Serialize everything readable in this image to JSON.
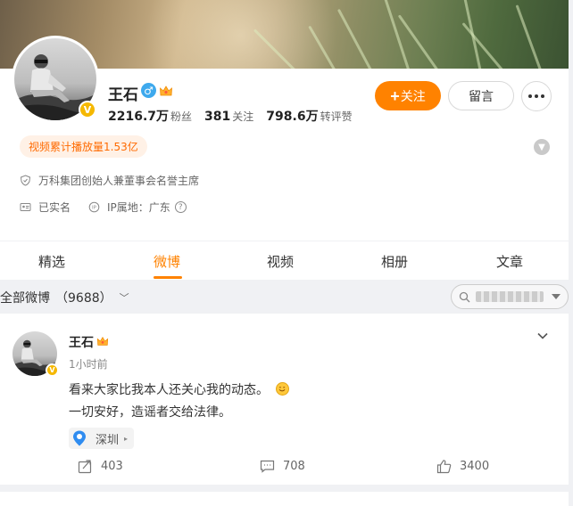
{
  "profile": {
    "name": "王石",
    "verified_badge": "V",
    "stats": [
      {
        "value": "2216.7万",
        "label": "粉丝"
      },
      {
        "value": "381",
        "label": "关注"
      },
      {
        "value": "798.6万",
        "label": "转评赞"
      }
    ],
    "follow_label": "关注",
    "message_label": "留言",
    "video_views": "视频累计播放量1.53亿",
    "description": "万科集团创始人兼董事会名誉主席",
    "real_name": "已实名",
    "ip_location": "IP属地：广东",
    "help_symbol": "?",
    "icons": [
      "gender-male-icon",
      "crown-icon",
      "more-icon",
      "expand-icon",
      "shield-icon",
      "id-card-icon",
      "ip-icon",
      "help-icon"
    ]
  },
  "tabs": [
    {
      "label": "精选",
      "active": false
    },
    {
      "label": "微博",
      "active": true
    },
    {
      "label": "视频",
      "active": false
    },
    {
      "label": "相册",
      "active": false
    },
    {
      "label": "文章",
      "active": false
    }
  ],
  "filter": {
    "label": "全部微博",
    "count": "（9688）"
  },
  "post": {
    "author": "王石",
    "time": "1小时前",
    "lines": [
      "看来大家比我本人还关心我的动态。",
      "一切安好，造谣者交给法律。"
    ],
    "location": "深圳",
    "reposts": "403",
    "comments": "708",
    "likes": "3400"
  },
  "colors": {
    "accent": "#ff8200",
    "verified": "#f5b800",
    "gender": "#3ea9ed",
    "pill_bg": "#fff1e6"
  }
}
